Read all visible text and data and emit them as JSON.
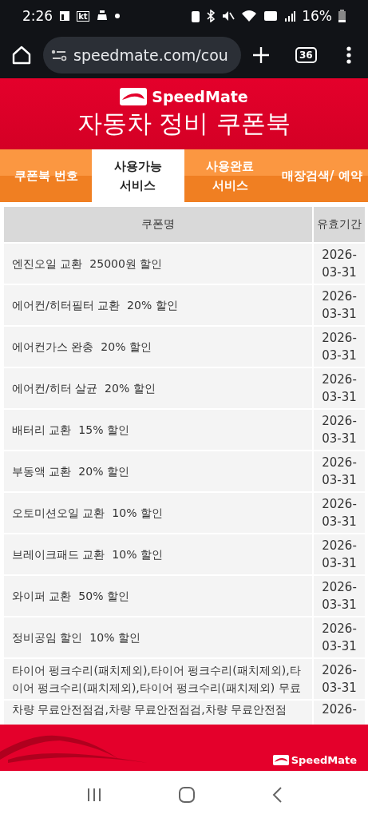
{
  "status_bar": {
    "time": "2:26",
    "carrier": "kt",
    "battery": "16%"
  },
  "browser": {
    "url": "speedmate.com/cou",
    "tab_count": "36"
  },
  "header": {
    "brand": "SpeedMate",
    "title": "자동차 정비 쿠폰북"
  },
  "tabs": [
    {
      "label": "쿠폰북 번호",
      "selected": false
    },
    {
      "label": "사용가능 서비스",
      "selected": true
    },
    {
      "label": "사용완료 서비스",
      "selected": false
    },
    {
      "label": "매장검색/ 예약",
      "selected": false
    }
  ],
  "table": {
    "columns": [
      "쿠폰명",
      "유효기간"
    ],
    "rows": [
      {
        "name": "엔진오일 교환  25000원 할인",
        "expiry": "2026-03-31"
      },
      {
        "name": "에어컨/히터필터 교환  20% 할인",
        "expiry": "2026-03-31"
      },
      {
        "name": "에어컨가스 완충  20% 할인",
        "expiry": "2026-03-31"
      },
      {
        "name": "에어컨/히터 살균  20% 할인",
        "expiry": "2026-03-31"
      },
      {
        "name": "배터리 교환  15% 할인",
        "expiry": "2026-03-31"
      },
      {
        "name": "부동액 교환  20% 할인",
        "expiry": "2026-03-31"
      },
      {
        "name": "오토미션오일 교환  10% 할인",
        "expiry": "2026-03-31"
      },
      {
        "name": "브레이크패드 교환  10% 할인",
        "expiry": "2026-03-31"
      },
      {
        "name": "와이퍼 교환  50% 할인",
        "expiry": "2026-03-31"
      },
      {
        "name": "정비공임 할인  10% 할인",
        "expiry": "2026-03-31"
      },
      {
        "name": "타이어 펑크수리(패치제외),타이어 펑크수리(패치제외),타이어 펑크수리(패치제외),타이어 펑크수리(패치제외) 무료",
        "expiry": "2026-03-31"
      },
      {
        "name": "차량 무료안전점검,차량 무료안전점검,차량 무료안전점",
        "expiry": "2026-"
      }
    ]
  },
  "footer": {
    "brand": "SpeedMate"
  }
}
